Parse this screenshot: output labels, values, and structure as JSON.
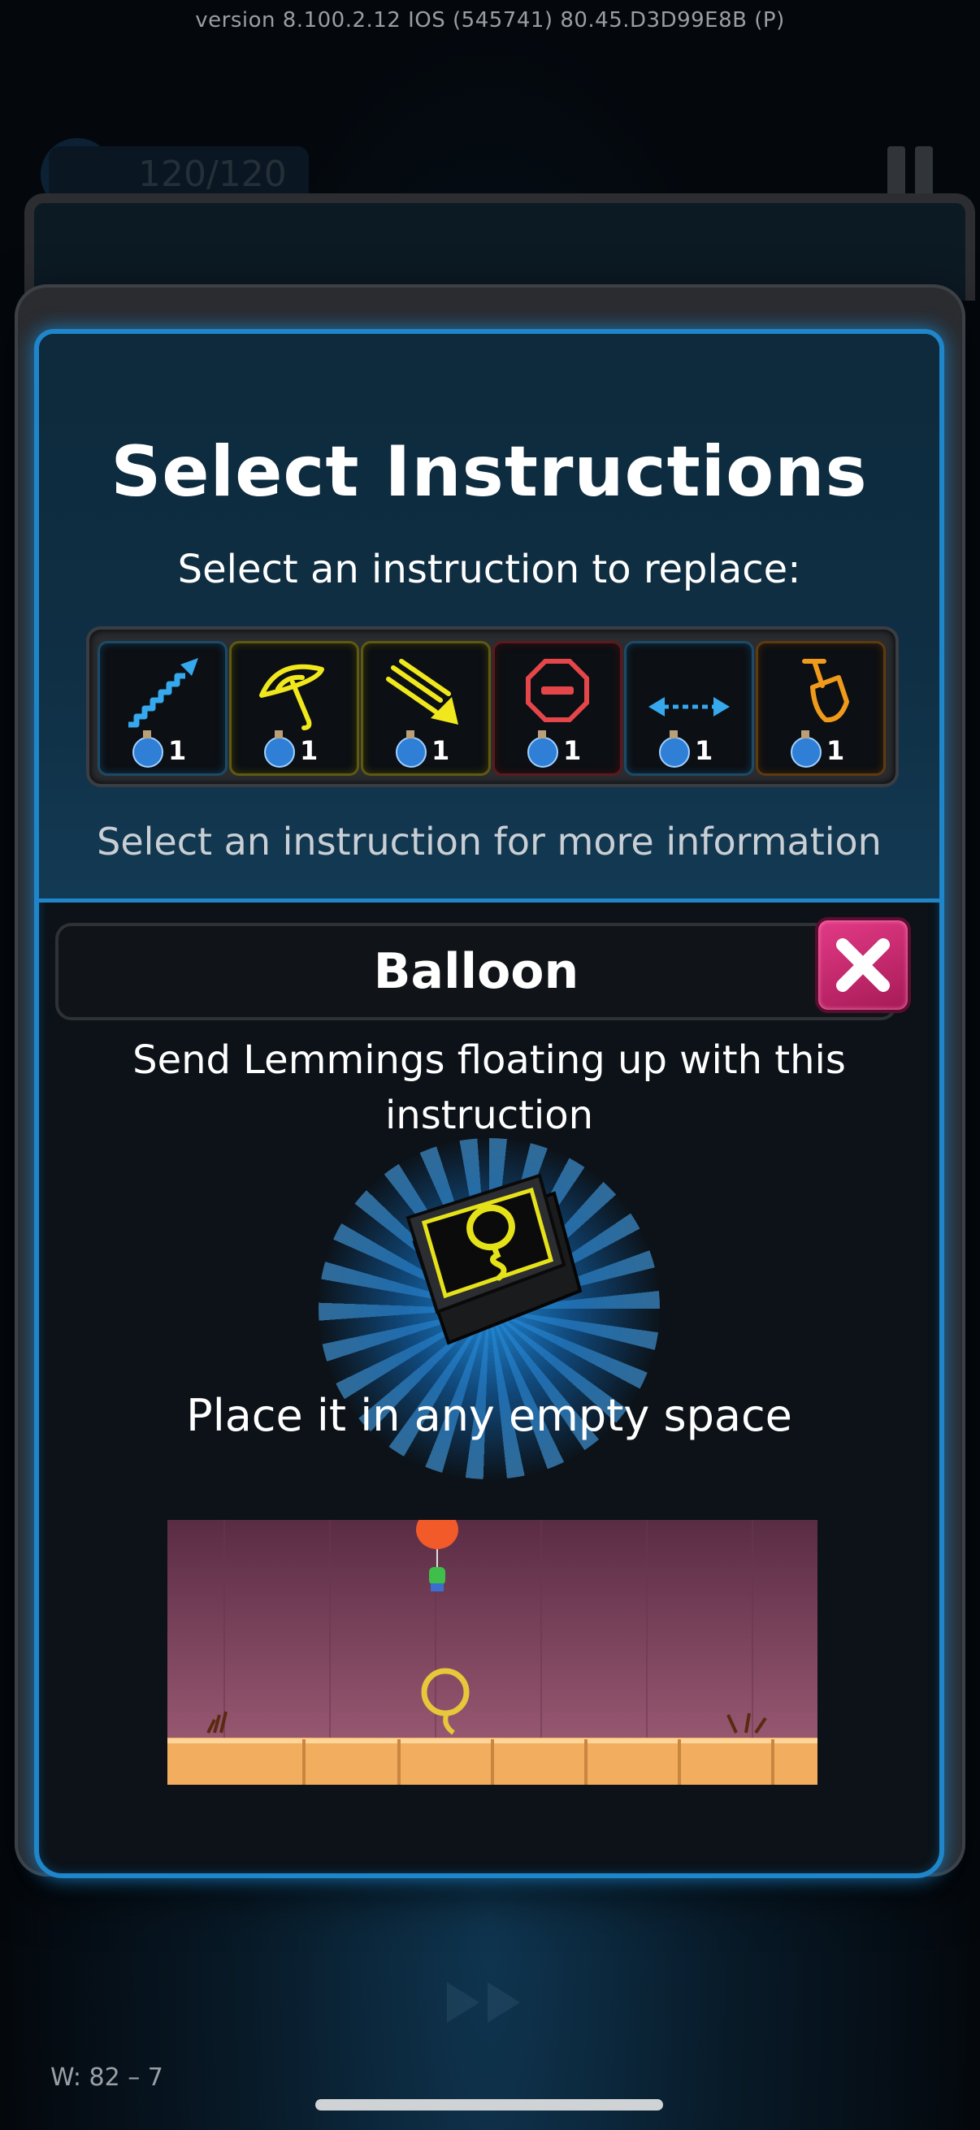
{
  "status": {
    "version_text": "version 8.100.2.12  IOS  (545741)    80.45.D3D99E8B (P)"
  },
  "background_hud": {
    "lemming_counter": "120/120"
  },
  "dialog": {
    "title": "Select Instructions",
    "subtitle": "Select an instruction to replace:",
    "slots": [
      {
        "icon": "stairs-icon",
        "count": "1",
        "color": "#35a8ee"
      },
      {
        "icon": "umbrella-icon",
        "count": "1",
        "color": "#f0e81c"
      },
      {
        "icon": "diagonal-arrows-icon",
        "count": "1",
        "color": "#f0e81c"
      },
      {
        "icon": "stop-sign-icon",
        "count": "1",
        "color": "#e4464a"
      },
      {
        "icon": "double-arrow-icon",
        "count": "1",
        "color": "#35a8ee"
      },
      {
        "icon": "shovel-icon",
        "count": "1",
        "color": "#f09a1c"
      }
    ],
    "hint": "Select an instruction for more information",
    "detail": {
      "name": "Balloon",
      "description": "Send Lemmings floating up with this instruction",
      "icon": "balloon-icon",
      "placement": "Place it in any empty space"
    }
  },
  "footer": {
    "world_label": "W: 82 – 7"
  },
  "colors": {
    "frame_blue": "#1f86c9",
    "close_pink": "#d42a76",
    "highlight_yellow": "#f0e81c"
  }
}
